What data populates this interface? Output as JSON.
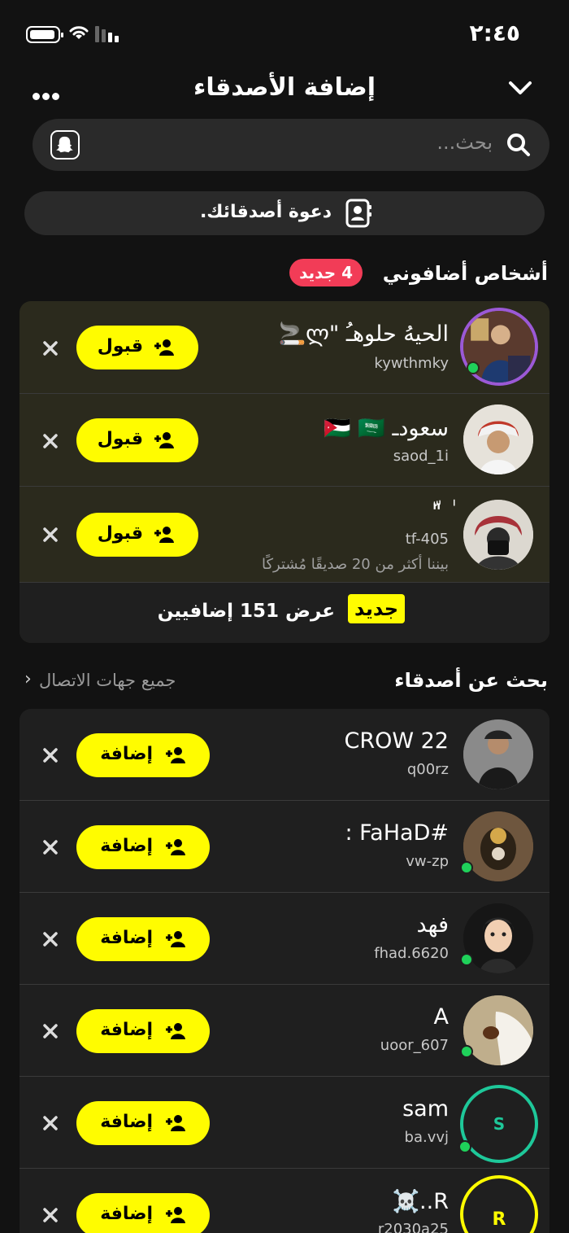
{
  "status": {
    "time": "٢:٤٥"
  },
  "header": {
    "title": "إضافة الأصدقاء"
  },
  "search": {
    "placeholder": "بحث..."
  },
  "invite": {
    "label": "دعوة أصدقائك."
  },
  "added_me": {
    "title": "أشخاص أضافوني",
    "badge": "4 جديد",
    "accept_label": "قبول",
    "items": [
      {
        "name": "الحيهُ حلوهـُ \"ლ🚬",
        "handle": "kywthmky",
        "meta": ""
      },
      {
        "name": "سعودـ 🇯🇴 🇸🇦",
        "handle": "saod_1i",
        "meta": ""
      },
      {
        "name": "ٰ \"ّ",
        "handle": "tf-405",
        "meta": "بيننا أكثر من 20 صديقًا مُشتركًا"
      }
    ],
    "footer_tag": "جديد",
    "footer_text": "عرض 151 إضافيين"
  },
  "find_friends": {
    "title": "بحث عن أصدقاء",
    "link": "جميع جهات الاتصال",
    "link_chevron": "‹",
    "add_label": "إضافة",
    "items": [
      {
        "name": "CROW 22",
        "handle": "q00rz"
      },
      {
        "name": "#FaHaD :",
        "handle": "vw-zp"
      },
      {
        "name": "فهد",
        "handle": "fhad.6620"
      },
      {
        "name": "A",
        "handle": "uoor_607"
      },
      {
        "name": "sam",
        "handle": "ba.vvj",
        "initial": "S"
      },
      {
        "name": "R..☠️",
        "handle": "r2030a25",
        "initial": "R"
      }
    ]
  },
  "colors": {
    "accent": "#fffc00",
    "badge": "#f23c57",
    "online": "#1fd15a",
    "ring_green": "#1ec89a",
    "ring_yellow": "#fffc00",
    "ring_purple": "#9b59d6"
  }
}
